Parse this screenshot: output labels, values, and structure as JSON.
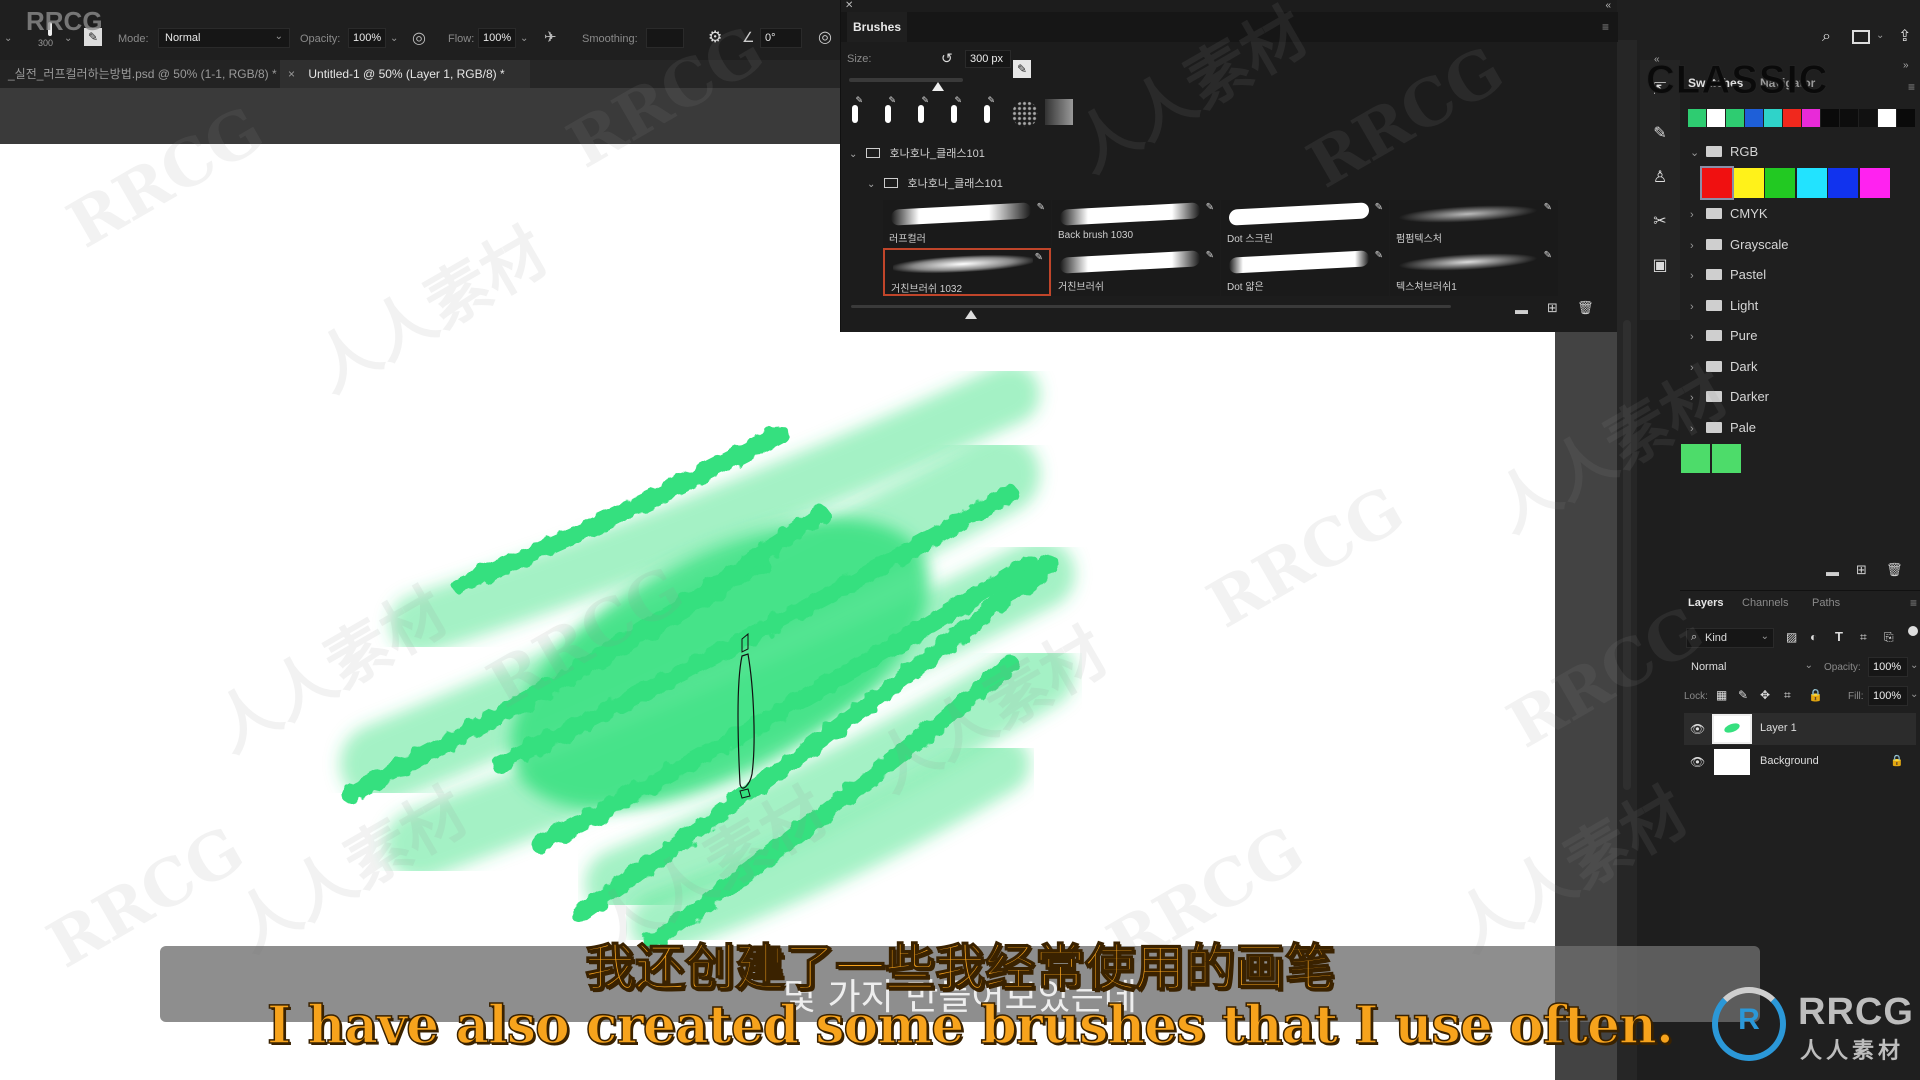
{
  "options_bar": {
    "brush_size": "300",
    "mode_label": "Mode:",
    "mode_value": "Normal",
    "opacity_label": "Opacity:",
    "opacity_value": "100%",
    "flow_label": "Flow:",
    "flow_value": "100%",
    "smoothing_label": "Smoothing:",
    "smoothing_value": "",
    "angle_value": "0°"
  },
  "doc_tabs": [
    {
      "label": "_실전_러프컬러하는방법.psd @ 50% (1-1, RGB/8) *",
      "active": false
    },
    {
      "label": "Untitled-1 @ 50% (Layer 1, RGB/8) *",
      "active": true
    }
  ],
  "brushes_panel": {
    "title": "Brushes",
    "size_label": "Size:",
    "size_value": "300 px",
    "size_slider_fraction": 0.78,
    "folders": [
      {
        "name": "호나호나_클래스101",
        "level": 0
      },
      {
        "name": "호나호나_클래스101",
        "level": 1
      }
    ],
    "brushes": [
      {
        "name": "러프컬러",
        "selected": false
      },
      {
        "name": "Back brush 1030",
        "selected": false
      },
      {
        "name": "Dot 스크린",
        "selected": false
      },
      {
        "name": "펌펌텍스처",
        "selected": false
      },
      {
        "name": "거친브러쉬 1032",
        "selected": true
      },
      {
        "name": "거친브러쉬",
        "selected": false
      },
      {
        "name": "Dot 얇은",
        "selected": false
      },
      {
        "name": "텍스쳐브러쉬1",
        "selected": false
      }
    ],
    "preview_slider_fraction": 0.2
  },
  "swatches_panel": {
    "tabs": [
      "Swatches",
      "Navigator"
    ],
    "overlay_text": "CLASSIC",
    "recent": [
      "#2ecc71",
      "#ffffff",
      "#2ecc71",
      "#1e5fd8",
      "#2fd3c9",
      "#f0281d",
      "#e82ad8",
      "#0a0a0a",
      "#0d0d0d",
      "#111111",
      "#ffffff",
      "#0a0a0a"
    ],
    "rgb_group": "RGB",
    "rgb_colors": [
      "#f01010",
      "#fff21a",
      "#22c922",
      "#22e3ff",
      "#1133ee",
      "#ff22f0"
    ],
    "groups": [
      "CMYK",
      "Grayscale",
      "Pastel",
      "Light",
      "Pure",
      "Dark",
      "Darker",
      "Pale"
    ],
    "custom": [
      "#4ddc6a",
      "#4ddc6a"
    ]
  },
  "layers_panel": {
    "tabs": [
      "Layers",
      "Channels",
      "Paths"
    ],
    "filter_kind": "Kind",
    "blend_mode": "Normal",
    "opacity_label": "Opacity:",
    "opacity_value": "100%",
    "lock_label": "Lock:",
    "fill_label": "Fill:",
    "fill_value": "100%",
    "layers": [
      {
        "name": "Layer 1",
        "selected": true,
        "visible": true,
        "locked": false
      },
      {
        "name": "Background",
        "selected": false,
        "visible": true,
        "locked": true
      }
    ]
  },
  "canvas": {
    "paint_color": "#36e07f"
  },
  "subtitles": {
    "korean": "몇 가지 만들어보았는데",
    "chinese": "我还创建了一些我经常使用的画笔",
    "english": "I have also created some brushes that I use often."
  },
  "watermark": {
    "logo_text": "RRCG",
    "logo_subtext": "人人素材",
    "corner_text": "RRCG"
  }
}
